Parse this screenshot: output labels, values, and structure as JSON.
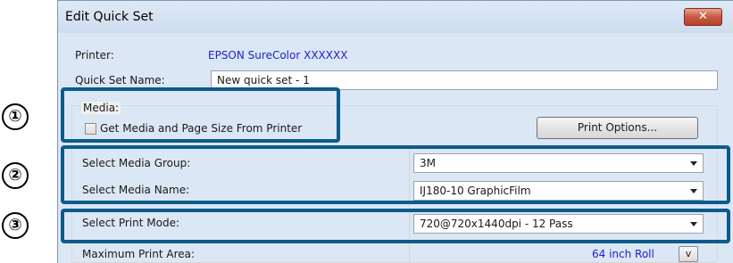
{
  "window": {
    "title": "Edit Quick Set",
    "close_glyph": "✕"
  },
  "printer": {
    "label": "Printer:",
    "value": "EPSON SureColor XXXXXX"
  },
  "quick_set_name": {
    "label": "Quick Set Name:",
    "value": "New quick set - 1"
  },
  "media": {
    "group_label": "Media:",
    "checkbox_label": "Get Media and Page Size From Printer",
    "checked": false,
    "print_options_button": "Print Options..."
  },
  "media_group": {
    "label": "Select Media Group:",
    "value": "3M"
  },
  "media_name": {
    "label": "Select Media Name:",
    "value": "IJ180-10 GraphicFilm"
  },
  "print_mode": {
    "label": "Select Print Mode:",
    "value": "720@720x1440dpi - 12 Pass"
  },
  "max_print_area": {
    "label": "Maximum Print Area:",
    "value": "64 inch Roll",
    "button": "v"
  },
  "callouts": [
    {
      "number": "①"
    },
    {
      "number": "②"
    },
    {
      "number": "③"
    }
  ],
  "colors": {
    "callout": "#0d5b8c",
    "title_bg": "#dbe7f4",
    "link_blue": "#2020d0"
  }
}
